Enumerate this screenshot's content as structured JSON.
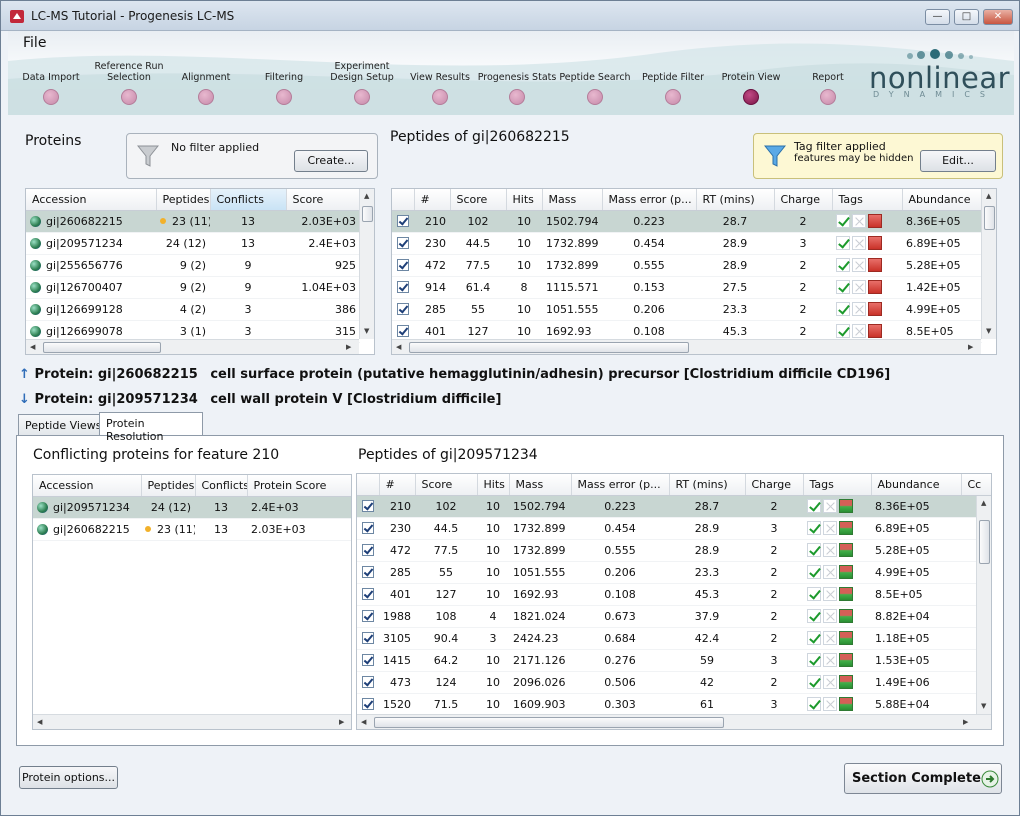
{
  "window": {
    "title": "LC-MS Tutorial - Progenesis LC-MS"
  },
  "menu": {
    "file": "File"
  },
  "workflow": {
    "steps": [
      {
        "label": "Data Import"
      },
      {
        "label": "Reference Run Selection"
      },
      {
        "label": "Alignment"
      },
      {
        "label": "Filtering"
      },
      {
        "label": "Experiment Design Setup"
      },
      {
        "label": "View Results"
      },
      {
        "label": "Progenesis Stats"
      },
      {
        "label": "Peptide Search"
      },
      {
        "label": "Peptide Filter"
      },
      {
        "label": "Protein View"
      },
      {
        "label": "Report"
      }
    ],
    "active_step": "Protein View"
  },
  "brand": {
    "name": "nonlinear",
    "sub": "DYNAMICS"
  },
  "proteins_panel": {
    "title": "Proteins",
    "filter_text": "No filter applied",
    "create_button": "Create...",
    "columns": [
      "Accession",
      "Peptides",
      "Conflicts",
      "Score"
    ],
    "rows": [
      {
        "accession": "gi|260682215",
        "peptides": "23 (11)",
        "conflicts": "13",
        "score": "2.03E+03",
        "flag": true,
        "selected": true
      },
      {
        "accession": "gi|209571234",
        "peptides": "24 (12)",
        "conflicts": "13",
        "score": "2.4E+03",
        "flag": false,
        "selected": false
      },
      {
        "accession": "gi|255656776",
        "peptides": "9 (2)",
        "conflicts": "9",
        "score": "925",
        "flag": false,
        "selected": false
      },
      {
        "accession": "gi|126700407",
        "peptides": "9 (2)",
        "conflicts": "9",
        "score": "1.04E+03",
        "flag": false,
        "selected": false
      },
      {
        "accession": "gi|126699128",
        "peptides": "4 (2)",
        "conflicts": "3",
        "score": "386",
        "flag": false,
        "selected": false
      },
      {
        "accession": "gi|126699078",
        "peptides": "3 (1)",
        "conflicts": "3",
        "score": "315",
        "flag": false,
        "selected": false
      }
    ]
  },
  "peptides_panel": {
    "title": "Peptides of gi|260682215",
    "tag_filter_title": "Tag filter applied",
    "tag_filter_sub": "features may be hidden",
    "edit_button": "Edit...",
    "columns": [
      "#",
      "Score",
      "Hits",
      "Mass",
      "Mass error (p...",
      "RT (mins)",
      "Charge",
      "Tags",
      "Abundance"
    ],
    "rows": [
      {
        "num": "210",
        "score": "102",
        "hits": "10",
        "mass": "1502.794",
        "err": "0.223",
        "rt": "28.7",
        "charge": "2",
        "abund": "8.36E+05",
        "tag": "red",
        "selected": true
      },
      {
        "num": "230",
        "score": "44.5",
        "hits": "10",
        "mass": "1732.899",
        "err": "0.454",
        "rt": "28.9",
        "charge": "3",
        "abund": "6.89E+05",
        "tag": "red",
        "selected": false
      },
      {
        "num": "472",
        "score": "77.5",
        "hits": "10",
        "mass": "1732.899",
        "err": "0.555",
        "rt": "28.9",
        "charge": "2",
        "abund": "5.28E+05",
        "tag": "red",
        "selected": false
      },
      {
        "num": "914",
        "score": "61.4",
        "hits": "8",
        "mass": "1115.571",
        "err": "0.153",
        "rt": "27.5",
        "charge": "2",
        "abund": "1.42E+05",
        "tag": "red",
        "selected": false
      },
      {
        "num": "285",
        "score": "55",
        "hits": "10",
        "mass": "1051.555",
        "err": "0.206",
        "rt": "23.3",
        "charge": "2",
        "abund": "4.99E+05",
        "tag": "red",
        "selected": false
      },
      {
        "num": "401",
        "score": "127",
        "hits": "10",
        "mass": "1692.93",
        "err": "0.108",
        "rt": "45.3",
        "charge": "2",
        "abund": "8.5E+05",
        "tag": "red",
        "selected": false
      }
    ]
  },
  "protein_lines": [
    {
      "direction": "up",
      "label": "Protein: gi|260682215",
      "desc": "cell surface protein (putative hemagglutinin/adhesin) precursor [Clostridium difficile CD196]"
    },
    {
      "direction": "down",
      "label": "Protein: gi|209571234",
      "desc": "cell wall protein V [Clostridium difficile]"
    }
  ],
  "tabs": [
    {
      "label": "Peptide Views",
      "active": false
    },
    {
      "label": "Protein Resolution",
      "active": true
    }
  ],
  "conflicting": {
    "title": "Conflicting proteins for feature 210",
    "columns": [
      "Accession",
      "Peptides",
      "Conflicts",
      "Protein Score"
    ],
    "rows": [
      {
        "accession": "gi|209571234",
        "peptides": "24 (12)",
        "conflicts": "13",
        "score": "2.4E+03",
        "flag": false,
        "selected": true
      },
      {
        "accession": "gi|260682215",
        "peptides": "23 (11)",
        "conflicts": "13",
        "score": "2.03E+03",
        "flag": true,
        "selected": false
      }
    ]
  },
  "lower_peptides": {
    "title": "Peptides of gi|209571234",
    "columns": [
      "#",
      "Score",
      "Hits",
      "Mass",
      "Mass error (p...",
      "RT (mins)",
      "Charge",
      "Tags",
      "Abundance",
      "Cc"
    ],
    "rows": [
      {
        "num": "210",
        "score": "102",
        "hits": "10",
        "mass": "1502.794",
        "err": "0.223",
        "rt": "28.7",
        "charge": "2",
        "abund": "8.36E+05",
        "tag": "grn",
        "selected": true
      },
      {
        "num": "230",
        "score": "44.5",
        "hits": "10",
        "mass": "1732.899",
        "err": "0.454",
        "rt": "28.9",
        "charge": "3",
        "abund": "6.89E+05",
        "tag": "grn",
        "selected": false
      },
      {
        "num": "472",
        "score": "77.5",
        "hits": "10",
        "mass": "1732.899",
        "err": "0.555",
        "rt": "28.9",
        "charge": "2",
        "abund": "5.28E+05",
        "tag": "grn",
        "selected": false
      },
      {
        "num": "285",
        "score": "55",
        "hits": "10",
        "mass": "1051.555",
        "err": "0.206",
        "rt": "23.3",
        "charge": "2",
        "abund": "4.99E+05",
        "tag": "grn",
        "selected": false
      },
      {
        "num": "401",
        "score": "127",
        "hits": "10",
        "mass": "1692.93",
        "err": "0.108",
        "rt": "45.3",
        "charge": "2",
        "abund": "8.5E+05",
        "tag": "grn",
        "selected": false
      },
      {
        "num": "1988",
        "score": "108",
        "hits": "4",
        "mass": "1821.024",
        "err": "0.673",
        "rt": "37.9",
        "charge": "2",
        "abund": "8.82E+04",
        "tag": "grn",
        "selected": false
      },
      {
        "num": "3105",
        "score": "90.4",
        "hits": "3",
        "mass": "2424.23",
        "err": "0.684",
        "rt": "42.4",
        "charge": "2",
        "abund": "1.18E+05",
        "tag": "grn",
        "selected": false
      },
      {
        "num": "1415",
        "score": "64.2",
        "hits": "10",
        "mass": "2171.126",
        "err": "0.276",
        "rt": "59",
        "charge": "3",
        "abund": "1.53E+05",
        "tag": "grn",
        "selected": false
      },
      {
        "num": "473",
        "score": "124",
        "hits": "10",
        "mass": "2096.026",
        "err": "0.506",
        "rt": "42",
        "charge": "2",
        "abund": "1.49E+06",
        "tag": "grn",
        "selected": false
      },
      {
        "num": "1520",
        "score": "71.5",
        "hits": "10",
        "mass": "1609.903",
        "err": "0.303",
        "rt": "61",
        "charge": "3",
        "abund": "5.88E+04",
        "tag": "grn",
        "selected": false
      }
    ]
  },
  "footer": {
    "protein_options": "Protein options...",
    "section_complete": "Section Complete"
  },
  "colors": {
    "accent": "#7a1546",
    "selected_row": "#c8d6d2",
    "tag_filter_bg": "#fdf8d4"
  }
}
